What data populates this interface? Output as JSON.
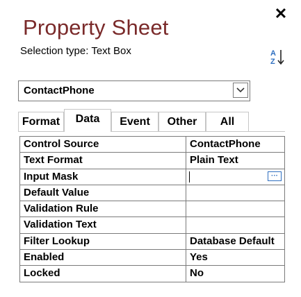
{
  "panel": {
    "title": "Property Sheet",
    "close_glyph": "✕",
    "selection_type_label": "Selection type:",
    "selection_type_value": "Text Box",
    "sort_icon": "sort-az-icon"
  },
  "object_selector": {
    "value": "ContactPhone"
  },
  "tabs": [
    {
      "label": "Format"
    },
    {
      "label": "Data"
    },
    {
      "label": "Event"
    },
    {
      "label": "Other"
    },
    {
      "label": "All"
    }
  ],
  "active_tab": "Data",
  "properties": [
    {
      "name": "Control Source",
      "value": "ContactPhone"
    },
    {
      "name": "Text Format",
      "value": "Plain Text"
    },
    {
      "name": "Input Mask",
      "value": ""
    },
    {
      "name": "Default Value",
      "value": ""
    },
    {
      "name": "Validation Rule",
      "value": ""
    },
    {
      "name": "Validation Text",
      "value": ""
    },
    {
      "name": "Filter Lookup",
      "value": "Database Default"
    },
    {
      "name": "Enabled",
      "value": "Yes"
    },
    {
      "name": "Locked",
      "value": "No"
    }
  ],
  "builder_glyph": "···",
  "colors": {
    "title": "#7a2a2a",
    "builder_border": "#2f6fc0"
  }
}
